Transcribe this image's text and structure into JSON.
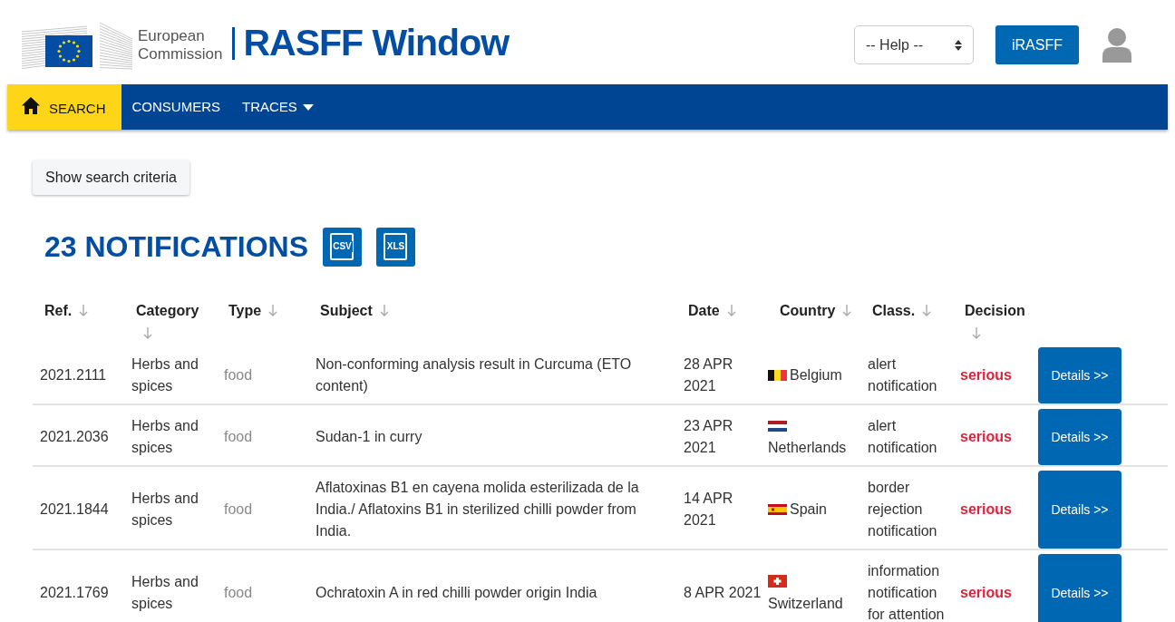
{
  "header": {
    "org": [
      "European",
      "Commission"
    ],
    "title": "RASFF Window",
    "help_select": {
      "value": "-- Help --"
    },
    "irasff_button": "iRASFF"
  },
  "nav": [
    {
      "label": "SEARCH",
      "selected": true,
      "kind": "home"
    },
    {
      "label": "CONSUMERS",
      "selected": false,
      "kind": "plain"
    },
    {
      "label": "TRACES",
      "selected": false,
      "kind": "dropdown"
    }
  ],
  "show_criteria_button": "Show search criteria",
  "results": {
    "heading": "23 NOTIFICATIONS",
    "exports": [
      "CSV",
      "XLS"
    ]
  },
  "table": {
    "columns": [
      "Ref.",
      "Category",
      "Type",
      "Subject",
      "Date",
      "Country",
      "Class.",
      "Decision"
    ],
    "rows": [
      {
        "ref": "2021.2111",
        "category": "Herbs and spices",
        "type": "food",
        "subject": "Non-conforming analysis result in Curcuma (ETO content)",
        "date": "28 APR 2021",
        "country": "Belgium",
        "kind": "be",
        "class": "alert notification",
        "decision": "serious",
        "action": "Details >>"
      },
      {
        "ref": "2021.2036",
        "category": "Herbs and spices",
        "type": "food",
        "subject": "Sudan-1 in curry",
        "date": "23 APR 2021",
        "country": "Netherlands",
        "kind": "nl",
        "class": "alert notification",
        "decision": "serious",
        "action": "Details >>"
      },
      {
        "ref": "2021.1844",
        "category": "Herbs and spices",
        "type": "food",
        "subject": "Aflatoxinas B1 en cayena molida esterilizada de la India./ Aflatoxins B1 in sterilized chilli powder from India.",
        "date": "14 APR 2021",
        "country": "Spain",
        "kind": "es",
        "class": "border rejection notification",
        "decision": "serious",
        "action": "Details >>"
      },
      {
        "ref": "2021.1769",
        "category": "Herbs and spices",
        "type": "food",
        "subject": "Ochratoxin A in red chilli powder origin India",
        "date": "8 APR 2021",
        "country": "Switzerland",
        "kind": "ch",
        "class": "information notification for attention",
        "decision": "serious",
        "action": "Details >>"
      }
    ]
  }
}
